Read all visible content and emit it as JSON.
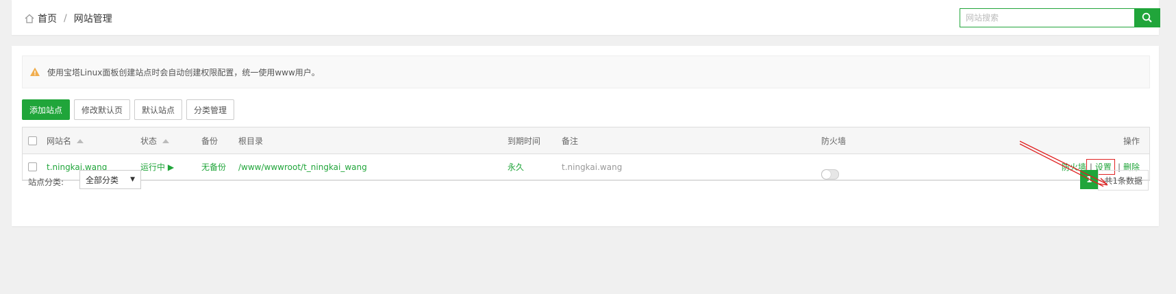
{
  "breadcrumb": {
    "home": "首页",
    "separator": "/",
    "current": "网站管理"
  },
  "search": {
    "placeholder": "网站搜索"
  },
  "notice": {
    "text": "使用宝塔Linux面板创建站点时会自动创建权限配置，统一使用www用户。"
  },
  "toolbar": {
    "add_site": "添加站点",
    "edit_default_page": "修改默认页",
    "default_site": "默认站点",
    "category_manage": "分类管理"
  },
  "table": {
    "headers": {
      "name": "网站名",
      "status": "状态",
      "backup": "备份",
      "root": "根目录",
      "expire": "到期时间",
      "remark": "备注",
      "firewall": "防火墙",
      "ops": "操作"
    },
    "rows": [
      {
        "name": "t.ningkai.wang",
        "status": "运行中 ▶",
        "backup": "无备份",
        "root": "/www/wwwroot/t_ningkai_wang",
        "expire": "永久",
        "remark": "t.ningkai.wang",
        "firewall_enabled": false,
        "ops": {
          "firewall": "防火墙",
          "settings": "设置",
          "delete": "删除",
          "sep": "|"
        }
      }
    ]
  },
  "footer": {
    "category_label": "站点分类:",
    "category_value": "全部分类",
    "page": "1",
    "total": "共1条数据"
  },
  "colors": {
    "accent": "#20a53a",
    "annotation": "#e02020",
    "warning": "#f0ad4e"
  }
}
